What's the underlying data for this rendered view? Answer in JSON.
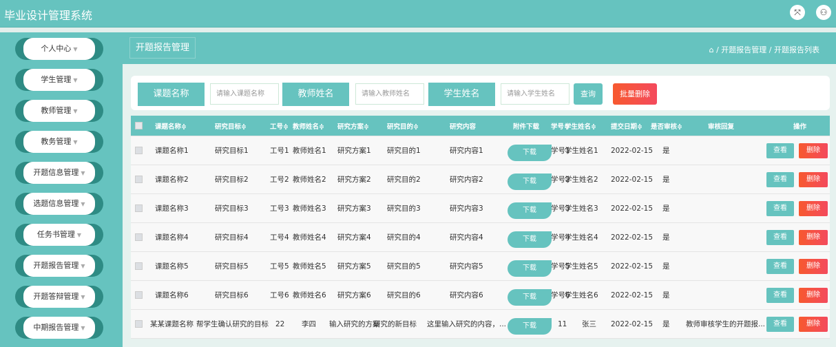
{
  "app": {
    "title": "毕业设计管理系统",
    "icons": [
      "fullscreen-icon",
      "user-icon"
    ]
  },
  "sidebar": {
    "items": [
      {
        "label": "个人中心"
      },
      {
        "label": "学生管理"
      },
      {
        "label": "教师管理"
      },
      {
        "label": "教务管理"
      },
      {
        "label": "开题信息管理"
      },
      {
        "label": "选题信息管理"
      },
      {
        "label": "任务书管理"
      },
      {
        "label": "开题报告管理"
      },
      {
        "label": "开题答辩管理"
      },
      {
        "label": "中期报告管理"
      }
    ]
  },
  "header": {
    "title": "开题报告管理",
    "breadcrumb": [
      "开题报告管理",
      "开题报告列表"
    ]
  },
  "search": {
    "topic_label": "课题名称",
    "topic_placeholder": "请输入课题名称",
    "teacher_label": "教师姓名",
    "teacher_placeholder": "请输入教师姓名",
    "student_label": "学生姓名",
    "student_placeholder": "请输入学生姓名",
    "query_btn": "查询",
    "batch_delete_btn": "批量删除"
  },
  "table": {
    "columns": [
      "课题名称≑",
      "研究目标≑",
      "工号≑",
      "教师姓名≑",
      "研究方案≑",
      "研究目的≑",
      "研究内容",
      "附件下载",
      "学号≑",
      "学生姓名≑",
      "提交日期≑",
      "是否审核≑",
      "审核回复",
      "操作"
    ],
    "download_label": "下载",
    "view_label": "查看",
    "delete_label": "删除",
    "rows": [
      [
        "课题名称1",
        "研究目标1",
        "工号1",
        "教师姓名1",
        "研究方案1",
        "研究目的1",
        "研究内容1",
        "学号1",
        "学生姓名1",
        "2022-02-15",
        "是",
        ""
      ],
      [
        "课题名称2",
        "研究目标2",
        "工号2",
        "教师姓名2",
        "研究方案2",
        "研究目的2",
        "研究内容2",
        "学号2",
        "学生姓名2",
        "2022-02-15",
        "是",
        ""
      ],
      [
        "课题名称3",
        "研究目标3",
        "工号3",
        "教师姓名3",
        "研究方案3",
        "研究目的3",
        "研究内容3",
        "学号3",
        "学生姓名3",
        "2022-02-15",
        "是",
        ""
      ],
      [
        "课题名称4",
        "研究目标4",
        "工号4",
        "教师姓名4",
        "研究方案4",
        "研究目的4",
        "研究内容4",
        "学号4",
        "学生姓名4",
        "2022-02-15",
        "是",
        ""
      ],
      [
        "课题名称5",
        "研究目标5",
        "工号5",
        "教师姓名5",
        "研究方案5",
        "研究目的5",
        "研究内容5",
        "学号5",
        "学生姓名5",
        "2022-02-15",
        "是",
        ""
      ],
      [
        "课题名称6",
        "研究目标6",
        "工号6",
        "教师姓名6",
        "研究方案6",
        "研究目的6",
        "研究内容6",
        "学号6",
        "学生姓名6",
        "2022-02-15",
        "是",
        ""
      ],
      [
        "某某课题名称",
        "帮学生确认研究的目标",
        "22",
        "李四",
        "输入研究的方案",
        "研究的新目标",
        "这里输入研究的内容，...",
        "11",
        "张三",
        "2022-02-15",
        "是",
        "教师审核学生的开题报..."
      ]
    ]
  }
}
